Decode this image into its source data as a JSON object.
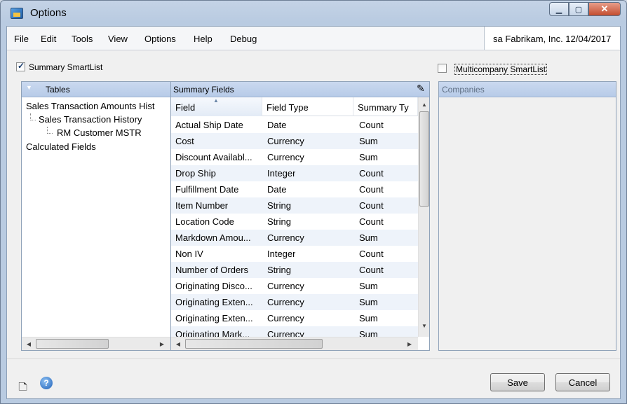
{
  "window": {
    "title": "Options"
  },
  "menu": [
    "File",
    "Edit",
    "Tools",
    "View",
    "Options",
    "Help",
    "Debug"
  ],
  "company_info": "sa  Fabrikam, Inc.  12/04/2017",
  "summary_checkbox": {
    "label": "Summary SmartList",
    "checked": true
  },
  "multicompany_checkbox": {
    "label": "Multicompany SmartList",
    "checked": false
  },
  "tables_panel": {
    "header": "Tables",
    "items": [
      {
        "label": "Sales Transaction Amounts Hist",
        "level": 0
      },
      {
        "label": "Sales Transaction History",
        "level": 1
      },
      {
        "label": "RM Customer MSTR",
        "level": 2
      },
      {
        "label": "Calculated Fields",
        "level": 0
      }
    ]
  },
  "summary_panel": {
    "header": "Summary Fields",
    "columns": [
      "Field",
      "Field Type",
      "Summary Ty"
    ],
    "rows": [
      [
        "Actual Ship Date",
        "Date",
        "Count"
      ],
      [
        "Cost",
        "Currency",
        "Sum"
      ],
      [
        "Discount Availabl...",
        "Currency",
        "Sum"
      ],
      [
        "Drop Ship",
        "Integer",
        "Count"
      ],
      [
        "Fulfillment Date",
        "Date",
        "Count"
      ],
      [
        "Item Number",
        "String",
        "Count"
      ],
      [
        "Location Code",
        "String",
        "Count"
      ],
      [
        "Markdown Amou...",
        "Currency",
        "Sum"
      ],
      [
        "Non IV",
        "Integer",
        "Count"
      ],
      [
        "Number of Orders",
        "String",
        "Count"
      ],
      [
        "Originating Disco...",
        "Currency",
        "Sum"
      ],
      [
        "Originating Exten...",
        "Currency",
        "Sum"
      ],
      [
        "Originating Exten...",
        "Currency",
        "Sum"
      ],
      [
        "Originating Mark...",
        "Currency",
        "Sum"
      ]
    ]
  },
  "companies_panel": {
    "header": "Companies"
  },
  "buttons": {
    "save": "Save",
    "cancel": "Cancel"
  },
  "icons": [
    "note-icon",
    "help-icon",
    "edit-icon",
    "sort-ascending-icon"
  ]
}
